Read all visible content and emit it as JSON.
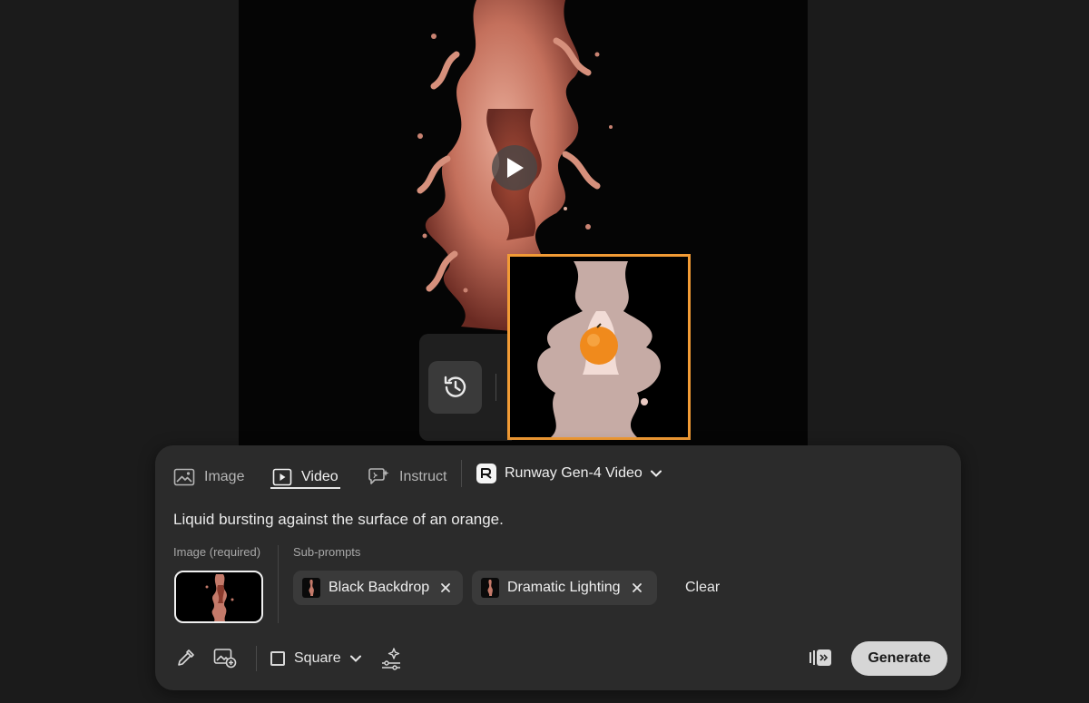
{
  "preview": {
    "play_icon": "play-icon"
  },
  "history": {
    "icon": "history-icon"
  },
  "panel": {
    "tabs": [
      {
        "label": "Image",
        "icon": "image-icon",
        "active": false
      },
      {
        "label": "Video",
        "icon": "video-icon",
        "active": true
      },
      {
        "label": "Instruct",
        "icon": "instruct-icon",
        "active": false
      }
    ],
    "model": {
      "label": "Runway Gen-4 Video",
      "icon": "runway-logo-icon"
    },
    "prompt": "Liquid bursting against the surface of an orange.",
    "image_label": "Image (required)",
    "subprompts_label": "Sub-prompts",
    "subprompts": [
      {
        "label": "Black Backdrop"
      },
      {
        "label": "Dramatic Lighting"
      }
    ],
    "clear_label": "Clear",
    "aspect": {
      "label": "Square"
    },
    "generate_label": "Generate",
    "colors": {
      "accent": "#f29b35",
      "panel": "#2b2b2b",
      "generate_bg": "#d6d6d6"
    }
  }
}
